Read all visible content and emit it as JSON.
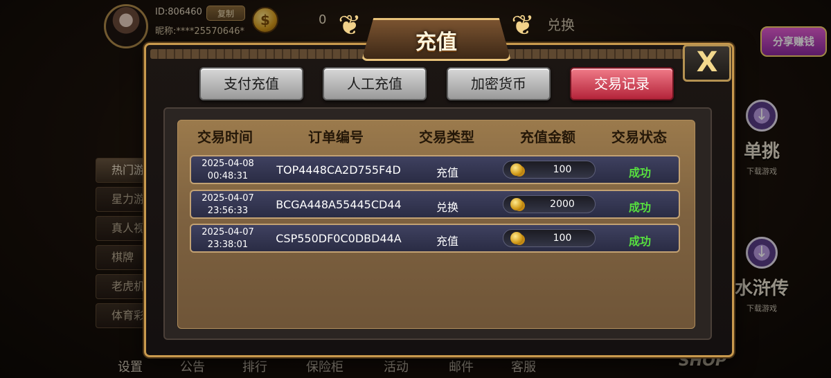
{
  "lobby": {
    "user_id": "ID:806460",
    "copy_label": "复制",
    "nickname": "昵称:****25570646*",
    "coin_symbol": "$",
    "balance": "0",
    "exchange_label": "兑换",
    "share_logo": "分享赚钱",
    "side_menu": [
      "热门游戏",
      "星力游戏",
      "真人视讯",
      "棋牌",
      "老虎机",
      "体育彩票"
    ],
    "games": [
      {
        "title": "单挑",
        "sub": "下载游戏"
      },
      {
        "title": "水浒传",
        "sub": "下载游戏"
      }
    ],
    "bottom_nav": [
      "设置",
      "公告",
      "排行",
      "保险柜",
      "活动",
      "邮件",
      "客服"
    ],
    "shop_label": "SHOP"
  },
  "dialog": {
    "title": "充值",
    "close_label": "X",
    "tabs": [
      {
        "label": "支付充值",
        "active": false
      },
      {
        "label": "人工充值",
        "active": false
      },
      {
        "label": "加密货币",
        "active": false
      },
      {
        "label": "交易记录",
        "active": true
      }
    ],
    "columns": [
      "交易时间",
      "订单编号",
      "交易类型",
      "充值金额",
      "交易状态"
    ],
    "records": [
      {
        "date": "2025-04-08",
        "time": "00:48:31",
        "order": "TOP4448CA2D755F4D",
        "type": "充值",
        "amount": "100",
        "status": "成功"
      },
      {
        "date": "2025-04-07",
        "time": "23:56:33",
        "order": "BCGA448A55445CD44",
        "type": "兑换",
        "amount": "2000",
        "status": "成功"
      },
      {
        "date": "2025-04-07",
        "time": "23:38:01",
        "order": "CSP550DF0C0DBD44A",
        "type": "充值",
        "amount": "100",
        "status": "成功"
      }
    ]
  },
  "colors": {
    "accent_gold": "#c99a4e",
    "active_tab": "#d9404f",
    "status_success": "#57e03f"
  }
}
